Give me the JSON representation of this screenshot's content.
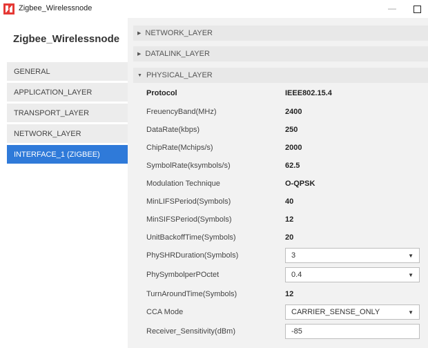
{
  "window": {
    "title": "Zigbee_Wirelessnode",
    "minimize": "—"
  },
  "sidebar": {
    "title": "Zigbee_Wirelessnode",
    "items": [
      {
        "label": "GENERAL",
        "active": false
      },
      {
        "label": "APPLICATION_LAYER",
        "active": false
      },
      {
        "label": "TRANSPORT_LAYER",
        "active": false
      },
      {
        "label": "NETWORK_LAYER",
        "active": false
      },
      {
        "label": "INTERFACE_1 (ZIGBEE)",
        "active": true
      }
    ]
  },
  "sections": [
    {
      "label": "NETWORK_LAYER",
      "expanded": false,
      "arrow": "▶"
    },
    {
      "label": "DATALINK_LAYER",
      "expanded": false,
      "arrow": "▶"
    },
    {
      "label": "PHYSICAL_LAYER",
      "expanded": true,
      "arrow": "▼"
    }
  ],
  "physical_layer": {
    "rows": [
      {
        "label": "Protocol",
        "value": "IEEE802.15.4"
      },
      {
        "label": "FreuencyBand(MHz)",
        "value": "2400"
      },
      {
        "label": "DataRate(kbps)",
        "value": "250"
      },
      {
        "label": "ChipRate(Mchips/s)",
        "value": "2000"
      },
      {
        "label": "SymbolRate(ksymbols/s)",
        "value": "62.5"
      },
      {
        "label": "Modulation Technique",
        "value": "O-QPSK"
      },
      {
        "label": "MinLIFSPeriod(Symbols)",
        "value": "40"
      },
      {
        "label": "MinSIFSPeriod(Symbols)",
        "value": "12"
      },
      {
        "label": "UnitBackoffTime(Symbols)",
        "value": "20"
      },
      {
        "label": "PhySHRDuration(Symbols)",
        "value": "3"
      },
      {
        "label": "PhySymbolperPOctet",
        "value": "0.4"
      },
      {
        "label": "TurnAroundTime(Symbols)",
        "value": "12"
      },
      {
        "label": "CCA Mode",
        "value": "CARRIER_SENSE_ONLY"
      },
      {
        "label": "Receiver_Sensitivity(dBm)",
        "value": "-85"
      }
    ],
    "caret": "▼"
  },
  "colors": {
    "accent": "#2f7ad9",
    "sidebar_item_bg": "#ececec",
    "panel_bg": "#f2f2f2",
    "section_header_bg": "#e8e8e8"
  },
  "icons": {
    "app": "netsim-logo-icon"
  }
}
